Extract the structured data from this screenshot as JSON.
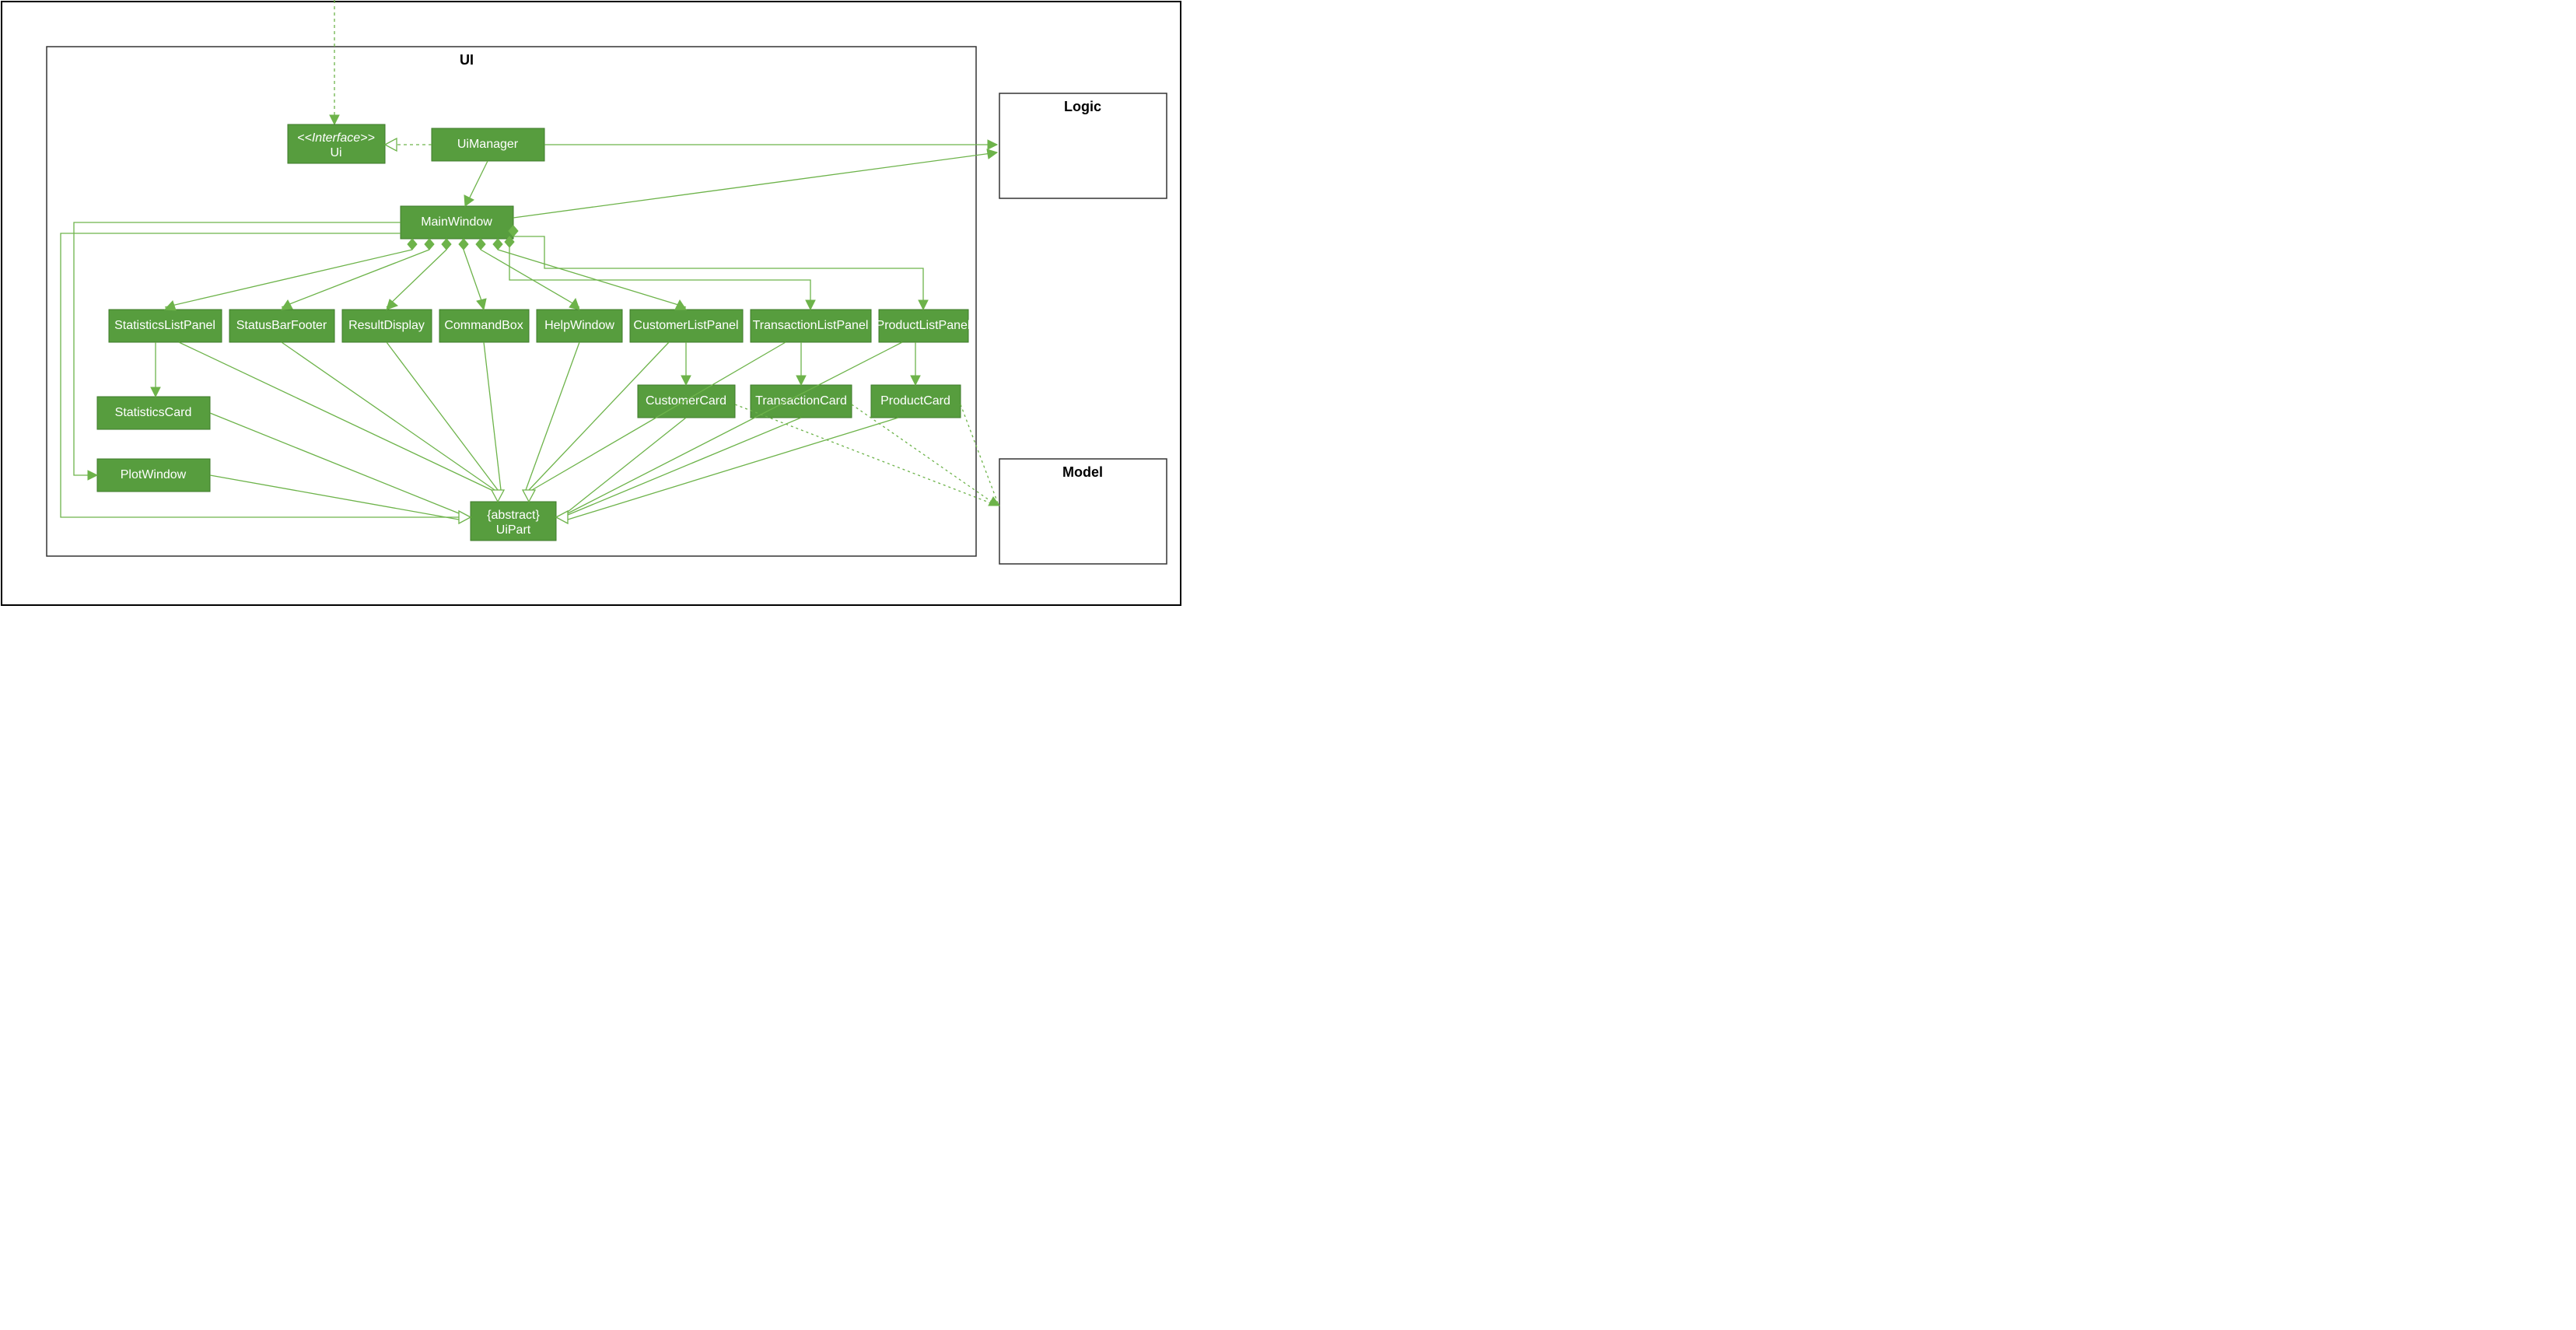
{
  "pkg": {
    "ui": "UI",
    "logic": "Logic",
    "model": "Model"
  },
  "n": {
    "ui_iface_top": "<<Interface>>",
    "ui_iface_bot": "Ui",
    "uimanager": "UiManager",
    "mainwindow": "MainWindow",
    "statslistpanel": "StatisticsListPanel",
    "statusbar": "StatusBarFooter",
    "resultdisplay": "ResultDisplay",
    "commandbox": "CommandBox",
    "helpwindow": "HelpWindow",
    "custlistpanel": "CustomerListPanel",
    "txnlistpanel": "TransactionListPanel",
    "prodlistpanel": "ProductListPanel",
    "statscard": "StatisticsCard",
    "plotwindow": "PlotWindow",
    "custcard": "CustomerCard",
    "txncard": "TransactionCard",
    "prodcard": "ProductCard",
    "uipart_top": "{abstract}",
    "uipart_bot": "UiPart"
  }
}
